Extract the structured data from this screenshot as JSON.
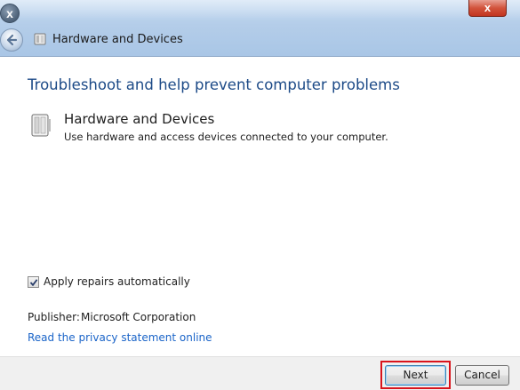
{
  "window": {
    "title": "Hardware and Devices",
    "close_glyph": "x",
    "sys_close_glyph": "x",
    "icons": {
      "back": "back-arrow-icon",
      "title": "troubleshooter-icon",
      "close": "close-icon"
    }
  },
  "main": {
    "heading": "Troubleshoot and help prevent computer problems",
    "item": {
      "icon": "hardware-device-icon",
      "title": "Hardware and Devices",
      "description": "Use hardware and access devices connected to your computer."
    },
    "apply_repairs": {
      "label": "Apply repairs automatically",
      "checked": true
    },
    "publisher": {
      "label": "Publisher:",
      "value": "Microsoft Corporation"
    },
    "privacy_link": "Read the privacy statement online"
  },
  "footer": {
    "next_label": "Next",
    "cancel_label": "Cancel",
    "highlight_color": "#d9141c"
  },
  "colors": {
    "heading": "#1c4a87",
    "link": "#1a64c8",
    "titlebar": "#b4cde9"
  }
}
